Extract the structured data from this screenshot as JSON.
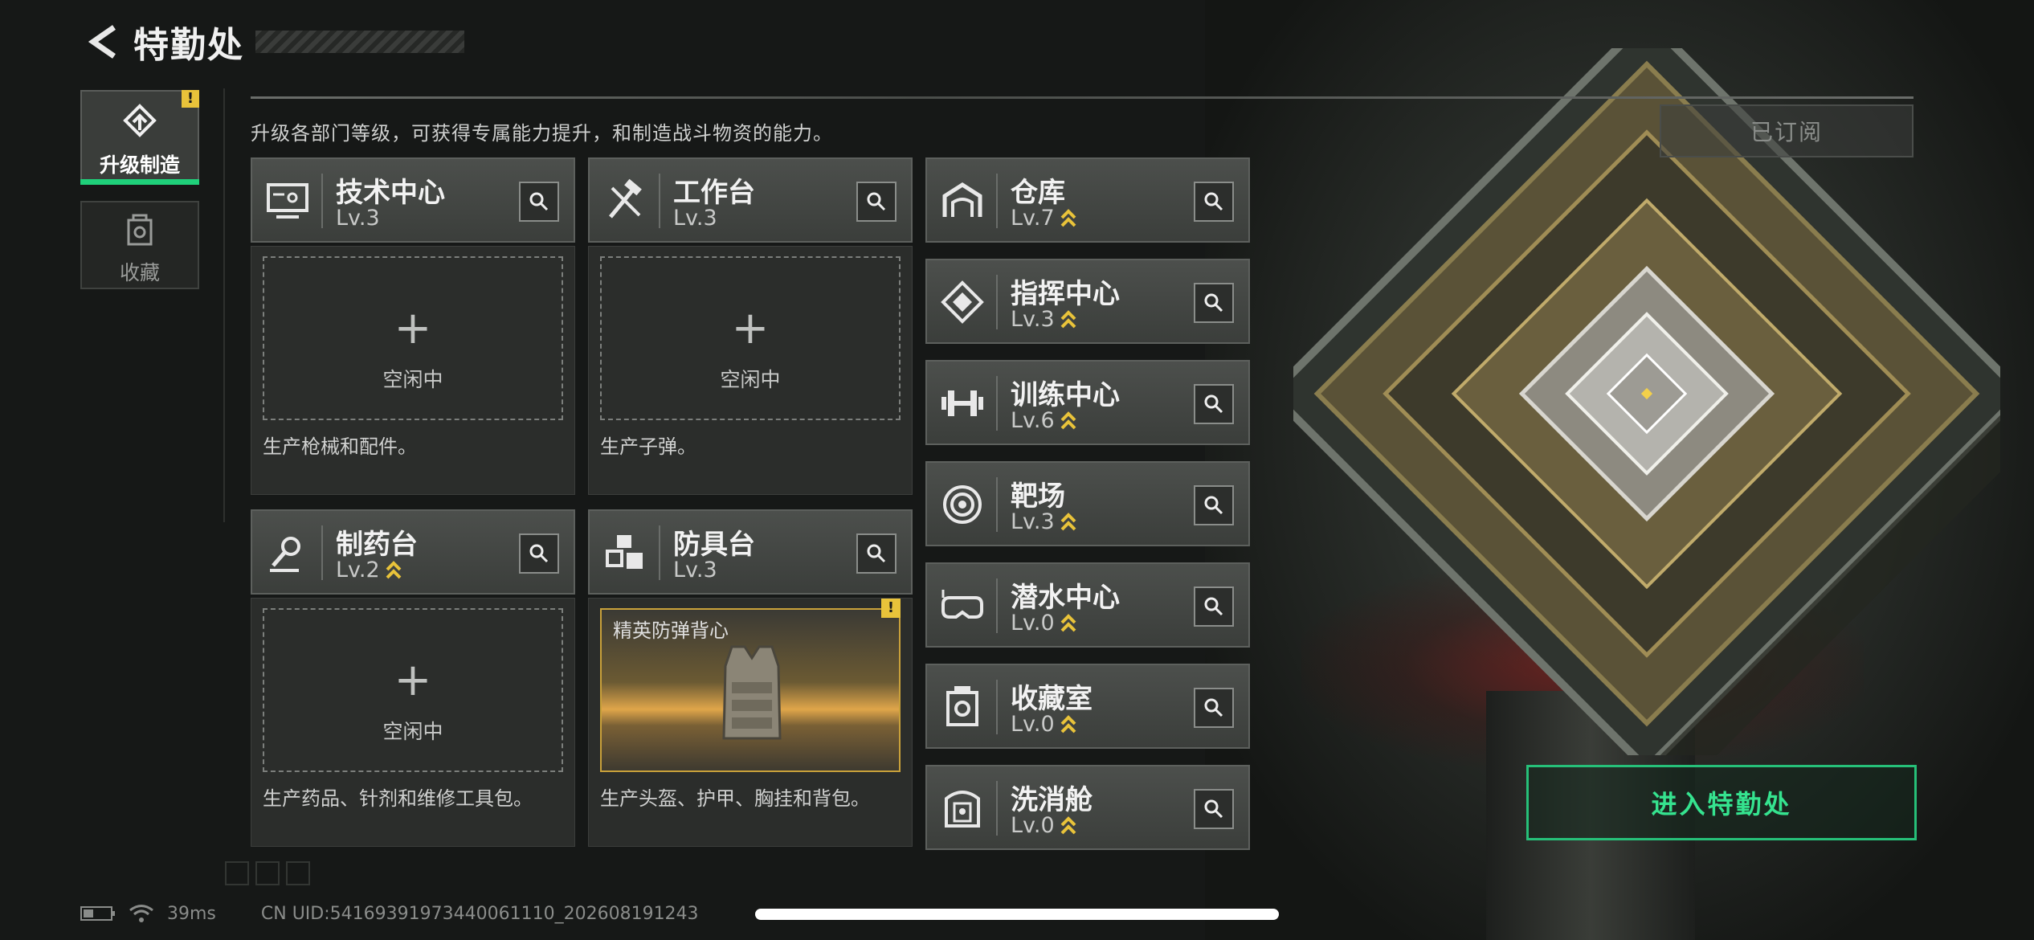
{
  "header": {
    "title": "特勤处",
    "back_icon": "chevron-left-icon"
  },
  "nav": [
    {
      "label": "升级制造",
      "icon": "upgrade-icon",
      "active": true,
      "badge": "!"
    },
    {
      "label": "收藏",
      "icon": "collection-icon",
      "active": false
    }
  ],
  "description": "升级各部门等级，可获得专属能力提升，和制造战斗物资的能力。",
  "subscribed_label": "已订阅",
  "workshops": [
    {
      "name": "技术中心",
      "level": "Lv.3",
      "upgradable": false,
      "icon": "tech-center-icon",
      "slot": {
        "type": "idle",
        "plus": "+",
        "status": "空闲中"
      },
      "desc": "生产枪械和配件。"
    },
    {
      "name": "工作台",
      "level": "Lv.3",
      "upgradable": false,
      "icon": "workbench-icon",
      "slot": {
        "type": "idle",
        "plus": "+",
        "status": "空闲中"
      },
      "desc": "生产子弹。"
    },
    {
      "name": "制药台",
      "level": "Lv.2",
      "upgradable": true,
      "icon": "pharmacy-icon",
      "slot": {
        "type": "idle",
        "plus": "+",
        "status": "空闲中"
      },
      "desc": "生产药品、针剂和维修工具包。"
    },
    {
      "name": "防具台",
      "level": "Lv.3",
      "upgradable": false,
      "icon": "armor-bench-icon",
      "slot": {
        "type": "item",
        "item_name": "精英防弹背心",
        "badge": "!"
      },
      "desc": "生产头盔、护甲、胸挂和背包。"
    }
  ],
  "facilities": [
    {
      "name": "仓库",
      "level": "Lv.7",
      "upgradable": true,
      "icon": "warehouse-icon"
    },
    {
      "name": "指挥中心",
      "level": "Lv.3",
      "upgradable": true,
      "icon": "command-center-icon"
    },
    {
      "name": "训练中心",
      "level": "Lv.6",
      "upgradable": true,
      "icon": "training-center-icon"
    },
    {
      "name": "靶场",
      "level": "Lv.3",
      "upgradable": true,
      "icon": "shooting-range-icon"
    },
    {
      "name": "潜水中心",
      "level": "Lv.0",
      "upgradable": true,
      "icon": "diving-center-icon"
    },
    {
      "name": "收藏室",
      "level": "Lv.0",
      "upgradable": true,
      "icon": "collection-room-icon"
    },
    {
      "name": "洗消舱",
      "level": "Lv.0",
      "upgradable": true,
      "icon": "decontamination-icon"
    }
  ],
  "enter_button": "进入特勤处",
  "status": {
    "ping": "39ms",
    "uid": "CN UID:54169391973440061110_202608191243"
  },
  "colors": {
    "accent_green": "#26c079",
    "upgrade_gold": "#e9c33a",
    "item_border": "#c9a13a"
  }
}
